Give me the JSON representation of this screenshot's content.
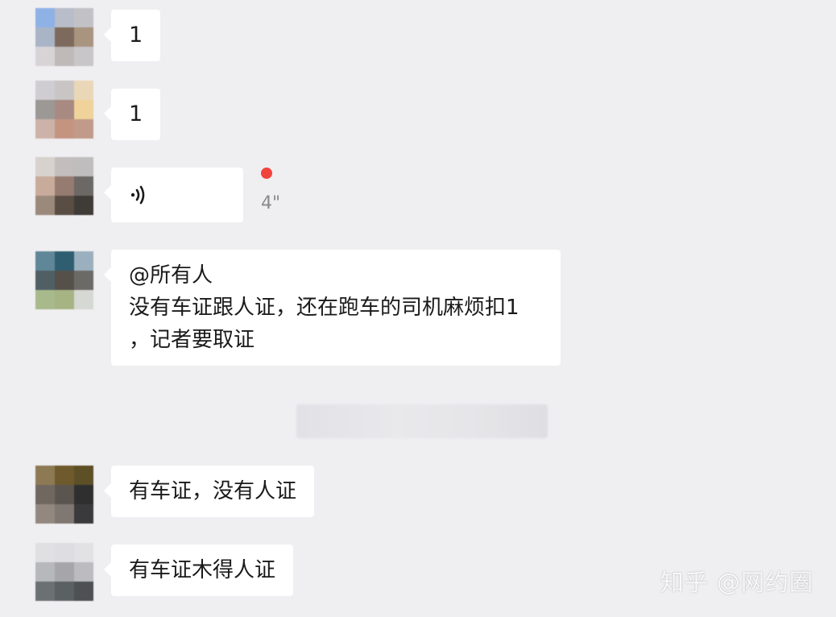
{
  "messages": [
    {
      "type": "text",
      "text": "1",
      "avatar_colors": [
        "#8fb2e6",
        "#b8bdc9",
        "#c2c2c6",
        "#a9b5c7",
        "#7d6a5c",
        "#a99480",
        "#d8d4d6",
        "#bfb9b9",
        "#c9c6c9"
      ]
    },
    {
      "type": "text",
      "text": "1",
      "avatar_colors": [
        "#cfcdd1",
        "#c9c5c5",
        "#ead7b8",
        "#9c9896",
        "#a88a83",
        "#f0d39a",
        "#ccb2a8",
        "#c49481",
        "#c29a8a"
      ]
    },
    {
      "type": "voice",
      "duration": "4\"",
      "unread": true,
      "avatar_colors": [
        "#d8d2cf",
        "#c3bdbd",
        "#bfbdbd",
        "#c8ab9a",
        "#967b70",
        "#6b6866",
        "#9b8a7c",
        "#5a4e44",
        "#3f3b36"
      ]
    },
    {
      "type": "text",
      "lines": [
        "@所有人",
        "没有车证跟人证，还在跑车的司机麻烦扣1",
        "，记者要取证"
      ],
      "avatar_colors": [
        "#5f8798",
        "#2f5e70",
        "#9ab0be",
        "#4f5f64",
        "#56504a",
        "#6c6a66",
        "#a8b98c",
        "#a6b483",
        "#d6d8d3"
      ]
    },
    {
      "type": "text",
      "text": "有车证，没有人证",
      "avatar_colors": [
        "#8d7a55",
        "#6e5a2c",
        "#5d4f26",
        "#706860",
        "#5b5550",
        "#2f2f2f",
        "#928880",
        "#7f7872",
        "#3a3a3c"
      ]
    },
    {
      "type": "text",
      "text": "有车证木得人证",
      "avatar_colors": [
        "#e0dfe2",
        "#dedde0",
        "#e2e1e4",
        "#b7b8bc",
        "#a6a6aa",
        "#bcbcc0",
        "#6b7073",
        "#5b6062",
        "#4d5153"
      ]
    }
  ],
  "watermark": "知乎 @网约圈",
  "colors": {
    "background": "#efeef1",
    "bubble": "#ffffff",
    "unread_dot": "#f0433c"
  }
}
